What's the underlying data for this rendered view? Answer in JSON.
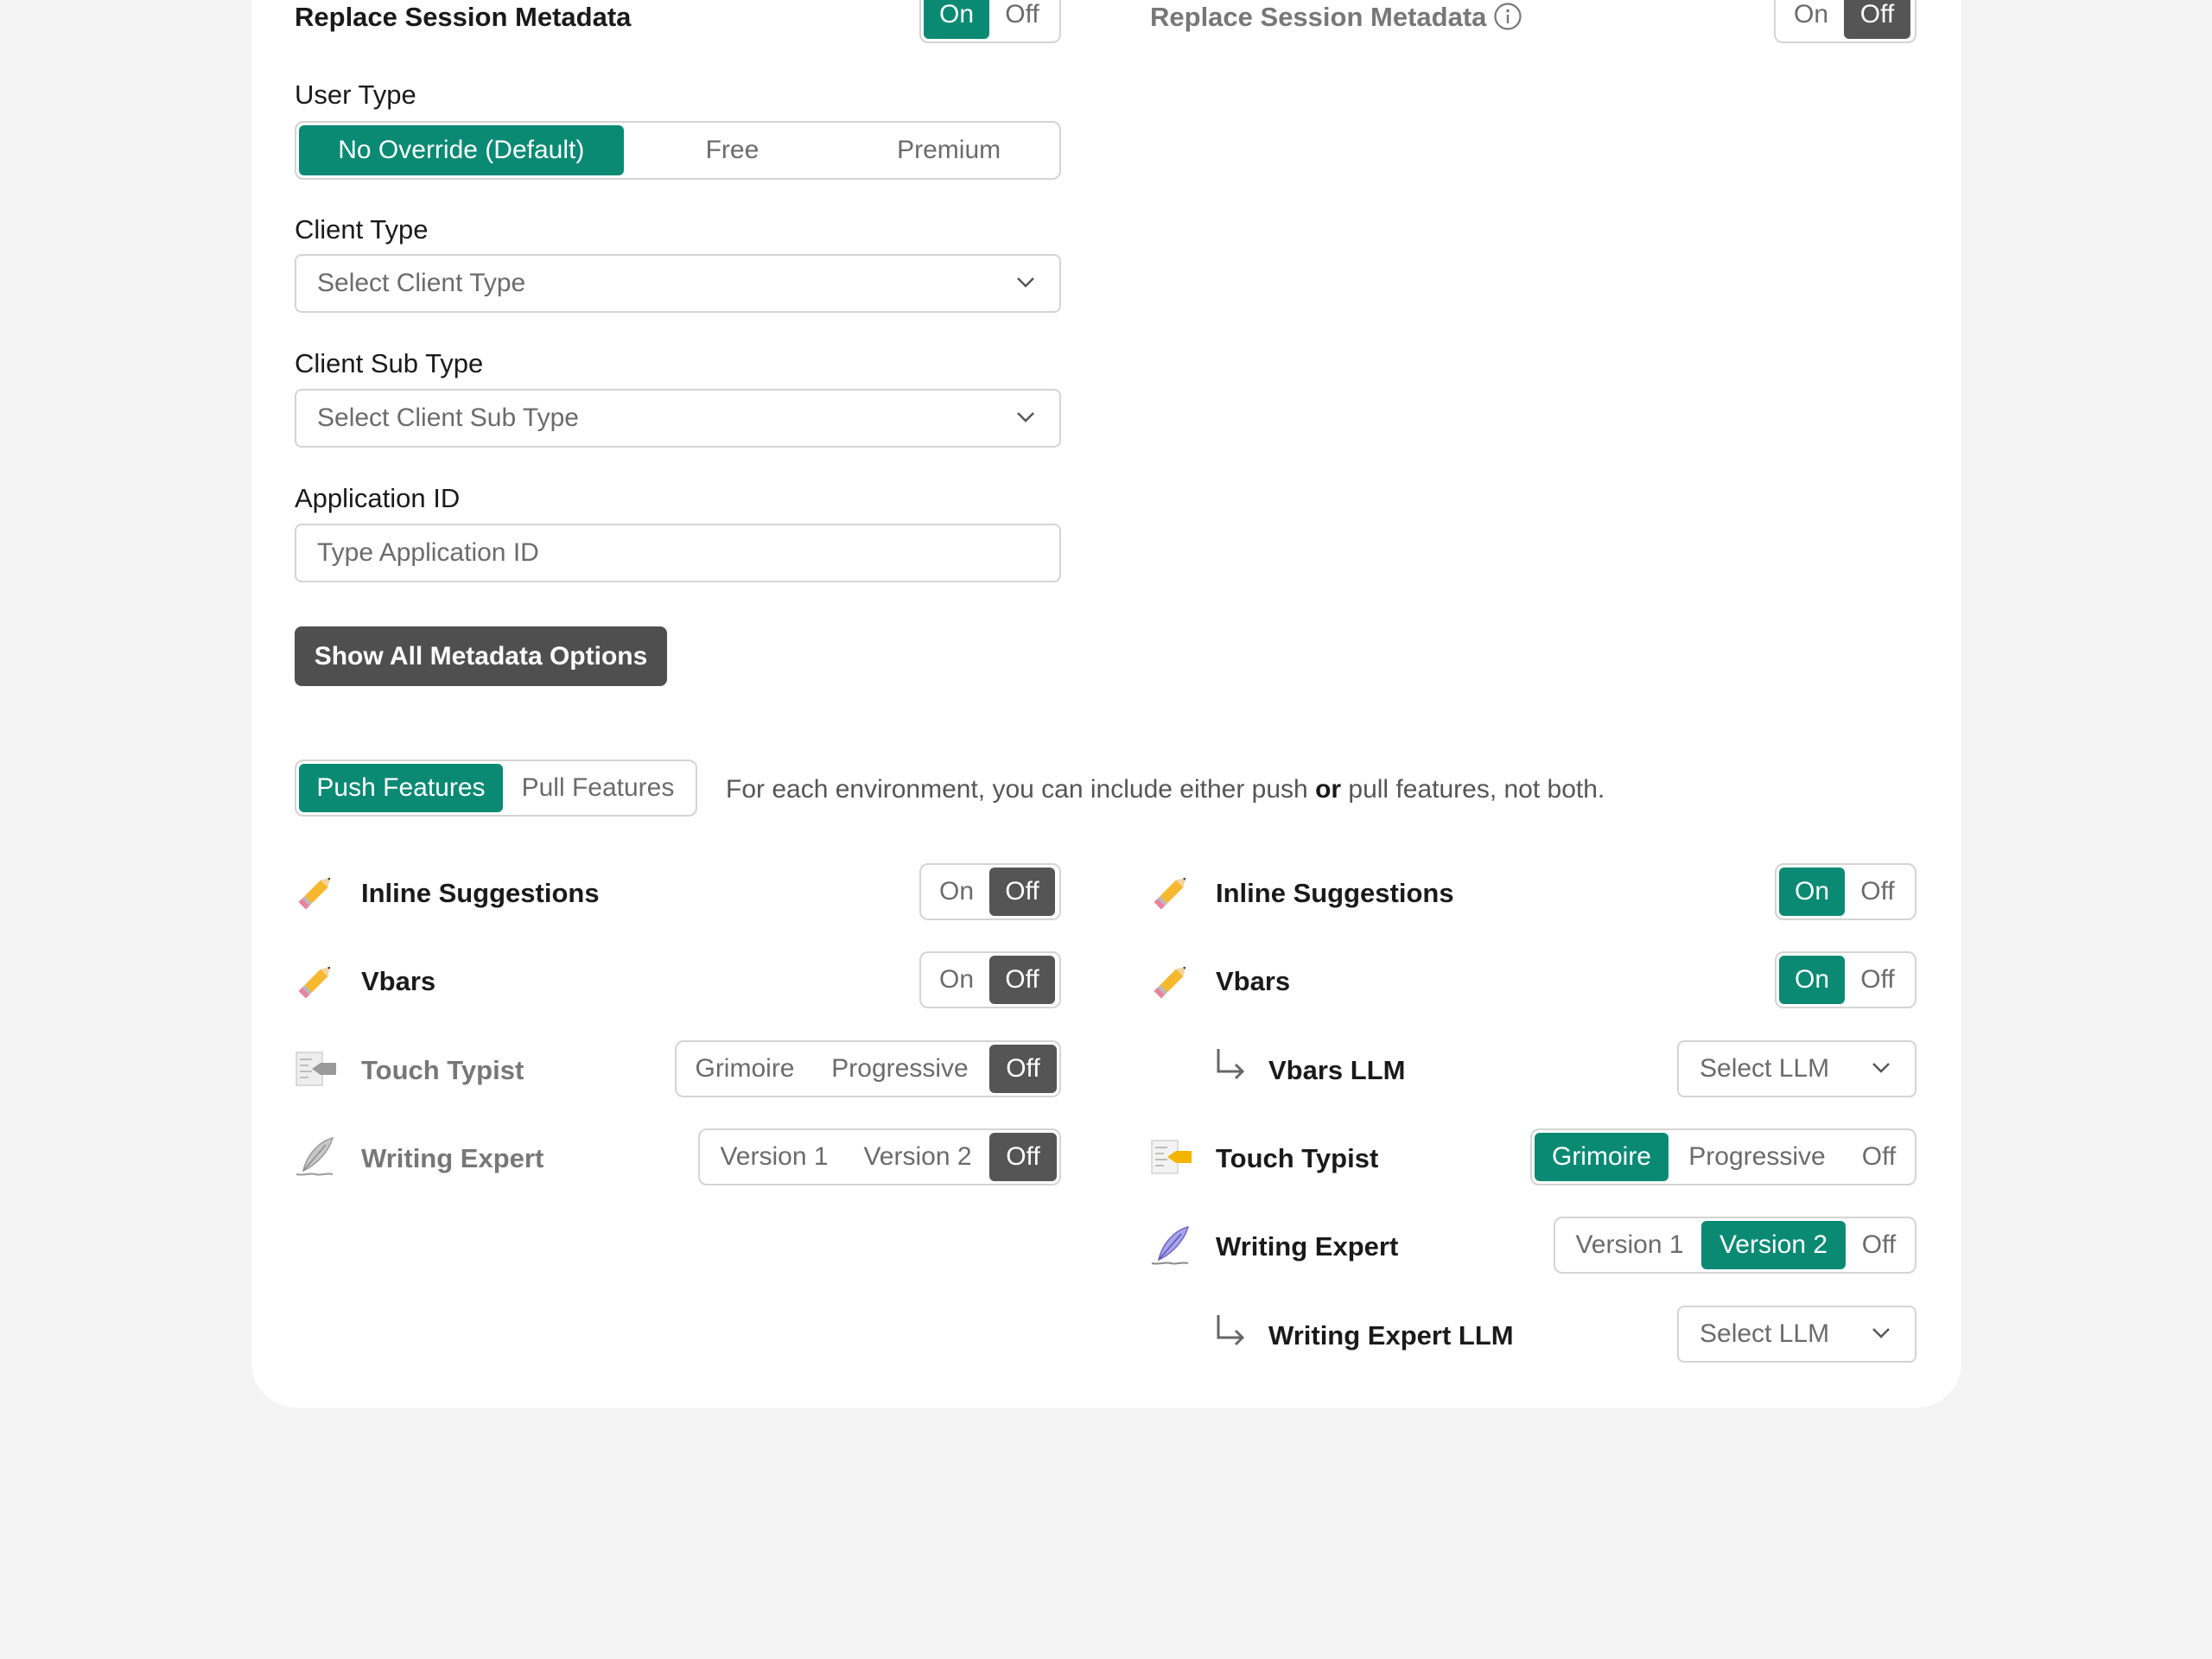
{
  "left": {
    "replace_session": {
      "label": "Replace Session Metadata",
      "on": "On",
      "off": "Off",
      "selected": "On"
    },
    "user_type": {
      "label": "User Type",
      "options": [
        "No Override (Default)",
        "Free",
        "Premium"
      ],
      "selected": "No Override (Default)"
    },
    "client_type": {
      "label": "Client Type",
      "placeholder": "Select Client Type"
    },
    "client_sub_type": {
      "label": "Client Sub Type",
      "placeholder": "Select Client Sub Type"
    },
    "application_id": {
      "label": "Application ID",
      "placeholder": "Type Application ID"
    },
    "show_all_button": "Show All Metadata Options"
  },
  "right": {
    "replace_session": {
      "label": "Replace Session Metadata",
      "on": "On",
      "off": "Off",
      "selected": "Off"
    }
  },
  "feature_tabs": {
    "push": "Push Features",
    "pull": "Pull Features",
    "selected": "Push Features",
    "description_pre": "For each environment, you can include either push ",
    "description_bold": "or",
    "description_post": " pull features, not both."
  },
  "features_left": {
    "inline": {
      "label": "Inline Suggestions",
      "icon": "pencil-icon",
      "on": "On",
      "off": "Off",
      "selected": "Off"
    },
    "vbars": {
      "label": "Vbars",
      "icon": "pencil-icon",
      "on": "On",
      "off": "Off",
      "selected": "Off"
    },
    "touch_typist": {
      "label": "Touch Typist",
      "icon": "touch-typist-icon",
      "options": [
        "Grimoire",
        "Progressive",
        "Off"
      ],
      "selected": "Off"
    },
    "writing_expert": {
      "label": "Writing Expert",
      "icon": "quill-icon",
      "options": [
        "Version 1",
        "Version 2",
        "Off"
      ],
      "selected": "Off"
    }
  },
  "features_right": {
    "inline": {
      "label": "Inline Suggestions",
      "icon": "pencil-icon",
      "on": "On",
      "off": "Off",
      "selected": "On"
    },
    "vbars": {
      "label": "Vbars",
      "icon": "pencil-icon",
      "on": "On",
      "off": "Off",
      "selected": "On"
    },
    "vbars_llm": {
      "label": "Vbars LLM",
      "placeholder": "Select LLM"
    },
    "touch_typist": {
      "label": "Touch Typist",
      "icon": "touch-typist-icon",
      "options": [
        "Grimoire",
        "Progressive",
        "Off"
      ],
      "selected": "Grimoire"
    },
    "writing_expert": {
      "label": "Writing Expert",
      "icon": "quill-icon",
      "options": [
        "Version 1",
        "Version 2",
        "Off"
      ],
      "selected": "Version 2"
    },
    "writing_expert_llm": {
      "label": "Writing Expert LLM",
      "placeholder": "Select LLM"
    }
  },
  "colors": {
    "accent_green": "#0a8a73",
    "selected_dark": "#555555",
    "page_background": "#f4f4f4"
  }
}
